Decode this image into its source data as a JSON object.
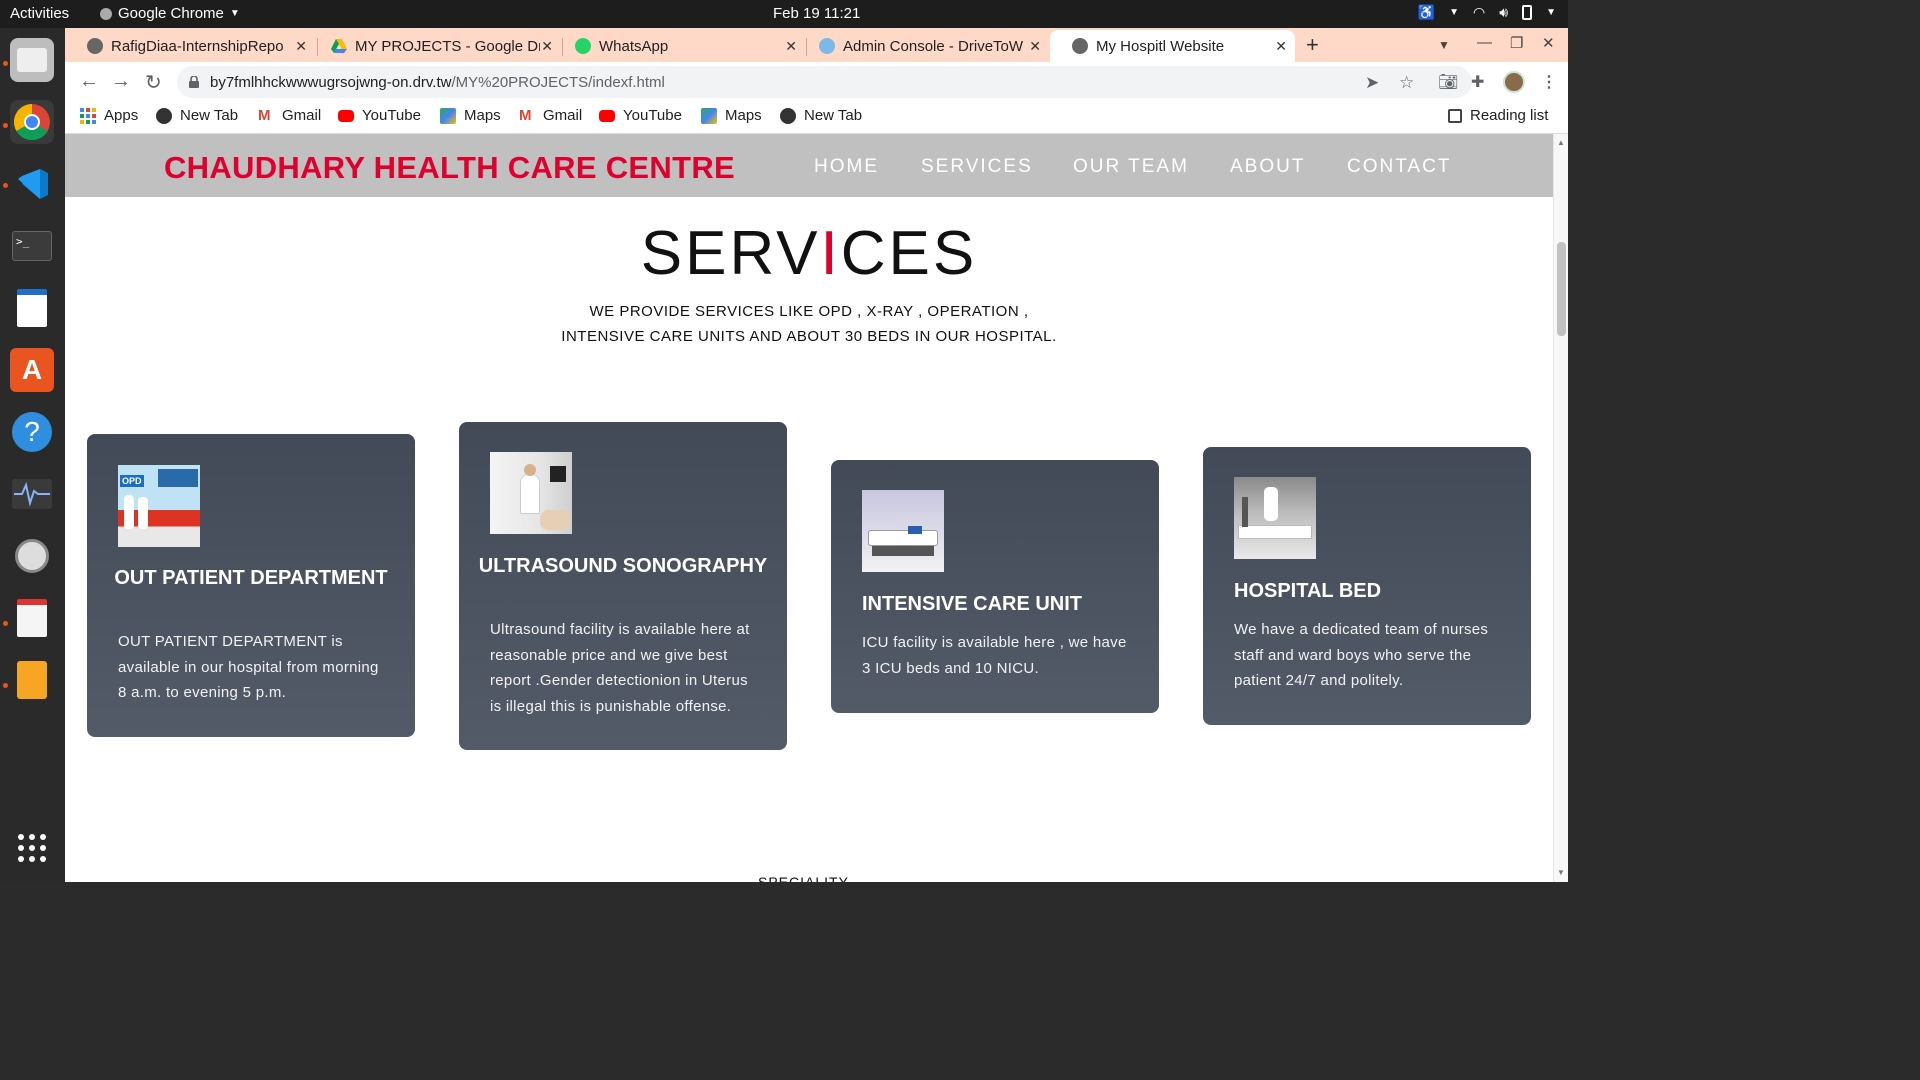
{
  "system_bar": {
    "activities": "Activities",
    "app_name": "Google Chrome",
    "clock": "Feb 19  11:21"
  },
  "dock": {
    "items": [
      "files-icon",
      "chrome-icon",
      "vscode-icon",
      "terminal-icon",
      "writer-icon",
      "software-center-icon",
      "help-icon",
      "system-monitor-icon",
      "disk-icon",
      "document-viewer-icon",
      "image-viewer-icon"
    ],
    "apps_grid_icon": "show-apps-icon"
  },
  "tabs": [
    {
      "title": "RafigDiaa-InternshipRepo",
      "icon": "globe-icon"
    },
    {
      "title": "MY PROJECTS - Google Drive",
      "icon": "drive-icon"
    },
    {
      "title": "WhatsApp",
      "icon": "whatsapp-icon"
    },
    {
      "title": "Admin Console - DriveToWeb",
      "icon": "drivetoweb-icon"
    },
    {
      "title": "My Hospitl Website",
      "icon": "globe-icon",
      "active": true
    }
  ],
  "address_bar": {
    "url_host": "by7fmlhhckwwwugrsojwng-on.drv.tw",
    "url_path": "/MY%20PROJECTS/indexf.html"
  },
  "bookmarks": {
    "items": [
      {
        "label": "Apps",
        "icon": "apps-grid-icon"
      },
      {
        "label": "New Tab",
        "icon": "globe-icon"
      },
      {
        "label": "Gmail",
        "icon": "gmail-icon"
      },
      {
        "label": "YouTube",
        "icon": "youtube-icon"
      },
      {
        "label": "Maps",
        "icon": "maps-icon"
      },
      {
        "label": "Gmail",
        "icon": "gmail-icon"
      },
      {
        "label": "YouTube",
        "icon": "youtube-icon"
      },
      {
        "label": "Maps",
        "icon": "maps-icon"
      },
      {
        "label": "New Tab",
        "icon": "globe-icon"
      }
    ],
    "reading_list": "Reading list"
  },
  "site": {
    "brand": "CHAUDHARY HEALTH CARE CENTRE",
    "brand_color": "#e0002d",
    "nav": [
      "HOME",
      "SERVICES",
      "OUR TEAM",
      "ABOUT",
      "CONTACT"
    ],
    "section": {
      "title_before": "SERV",
      "title_highlight": "I",
      "title_after": "CES",
      "subtitle": "WE PROVIDE SERVICES LIKE OPD , X-RAY , OPERATION , INTENSIVE CARE UNITS AND ABOUT 30 BEDS IN OUR HOSPITAL."
    },
    "cards": [
      {
        "title": "OUT PATIENT DEPARTMENT",
        "body": "OUT PATIENT DEPARTMENT is available in our hospital from morning 8 a.m. to evening 5 p.m.",
        "image": "opd-photo",
        "image_text": "OPD"
      },
      {
        "title": "ULTRASOUND SONOGRAPHY",
        "body": "Ultrasound facility is available here at reasonable price and we give best report .Gender detectionion in Uterus is illegal this is punishable offense.",
        "image": "ultrasound-photo"
      },
      {
        "title": "INTENSIVE CARE UNIT",
        "body": "ICU facility is available here , we have 3 ICU beds and 10 NICU.",
        "image": "icu-photo"
      },
      {
        "title": "HOSPITAL BED",
        "body": "We have a dedicated team of nurses staff and ward boys who serve the patient 24/7 and politely.",
        "image": "hospital-bed-photo"
      }
    ],
    "next_section_heading": "SPECIALITY"
  }
}
